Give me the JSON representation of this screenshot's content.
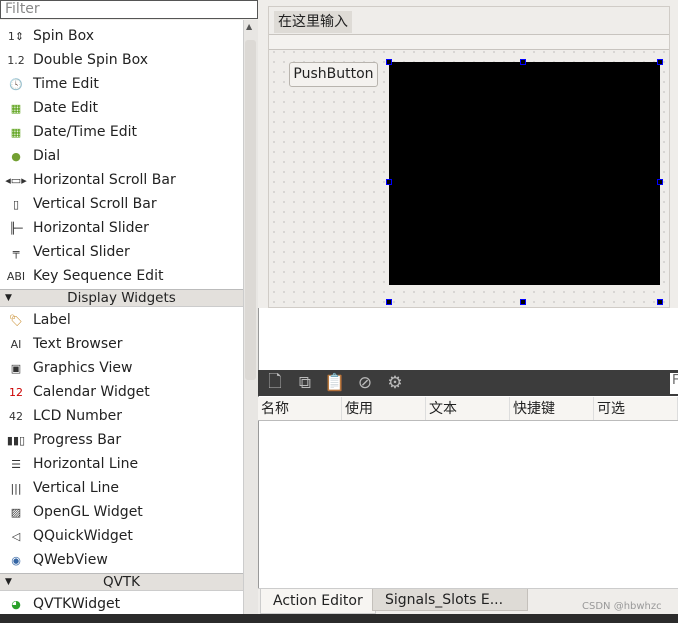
{
  "filter": {
    "placeholder": "Filter"
  },
  "widget_list": [
    {
      "type": "item",
      "label": "Spin Box",
      "icon": "spin-box-icon"
    },
    {
      "type": "item",
      "label": "Double Spin Box",
      "icon": "double-spin-box-icon"
    },
    {
      "type": "item",
      "label": "Time Edit",
      "icon": "clock-icon"
    },
    {
      "type": "item",
      "label": "Date Edit",
      "icon": "calendar-icon"
    },
    {
      "type": "item",
      "label": "Date/Time Edit",
      "icon": "calendar-clock-icon"
    },
    {
      "type": "item",
      "label": "Dial",
      "icon": "dial-icon"
    },
    {
      "type": "item",
      "label": "Horizontal Scroll Bar",
      "icon": "horizontal-scrollbar-icon"
    },
    {
      "type": "item",
      "label": "Vertical Scroll Bar",
      "icon": "vertical-scrollbar-icon"
    },
    {
      "type": "item",
      "label": "Horizontal Slider",
      "icon": "horizontal-slider-icon"
    },
    {
      "type": "item",
      "label": "Vertical Slider",
      "icon": "vertical-slider-icon"
    },
    {
      "type": "item",
      "label": "Key Sequence Edit",
      "icon": "key-sequence-icon"
    },
    {
      "type": "category",
      "label": "Display Widgets"
    },
    {
      "type": "item",
      "label": "Label",
      "icon": "label-tag-icon"
    },
    {
      "type": "item",
      "label": "Text Browser",
      "icon": "text-browser-icon"
    },
    {
      "type": "item",
      "label": "Graphics View",
      "icon": "graphics-view-icon"
    },
    {
      "type": "item",
      "label": "Calendar Widget",
      "icon": "calendar-widget-icon"
    },
    {
      "type": "item",
      "label": "LCD Number",
      "icon": "lcd-number-icon"
    },
    {
      "type": "item",
      "label": "Progress Bar",
      "icon": "progress-bar-icon"
    },
    {
      "type": "item",
      "label": "Horizontal Line",
      "icon": "horizontal-line-icon"
    },
    {
      "type": "item",
      "label": "Vertical Line",
      "icon": "vertical-line-icon"
    },
    {
      "type": "item",
      "label": "OpenGL Widget",
      "icon": "opengl-icon"
    },
    {
      "type": "item",
      "label": "QQuickWidget",
      "icon": "qquick-icon"
    },
    {
      "type": "item",
      "label": "QWebView",
      "icon": "globe-icon"
    },
    {
      "type": "category",
      "label": "QVTK"
    },
    {
      "type": "item",
      "label": "QVTKWidget",
      "icon": "qvtk-icon"
    }
  ],
  "form": {
    "menu_item": "在这里输入",
    "push_button": "PushButton"
  },
  "action_editor": {
    "toolbar": [
      "new-action-icon",
      "copy-icon",
      "paste-icon",
      "delete-icon",
      "settings-gear-icon"
    ],
    "filter_partial": "F",
    "columns": [
      "名称",
      "使用",
      "文本",
      "快捷键",
      "可选"
    ]
  },
  "tabs": [
    "Action Editor",
    "Signals_Slots E..."
  ],
  "watermark": "CSDN @hbwhzc"
}
